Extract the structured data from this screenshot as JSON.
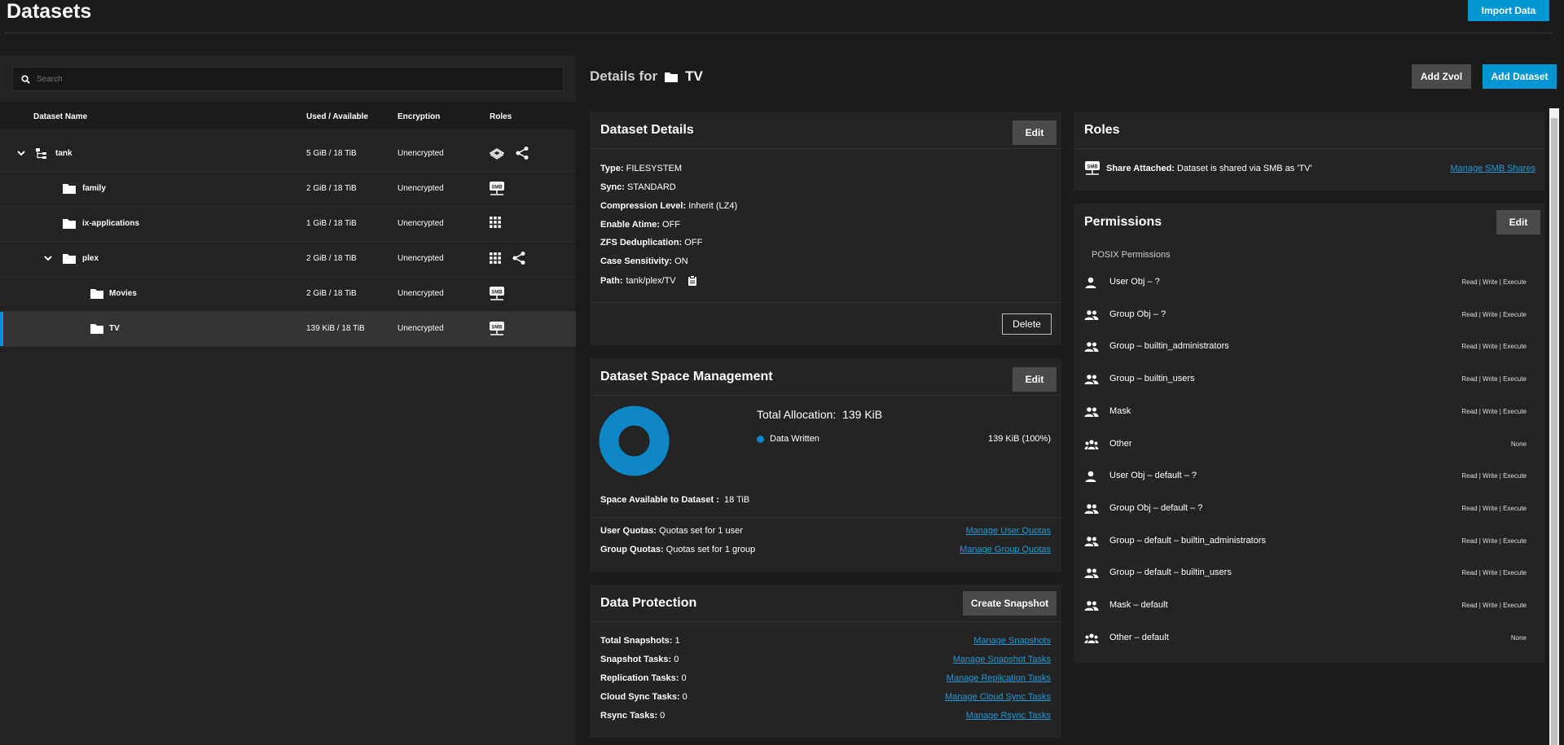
{
  "page": {
    "title": "Datasets",
    "import_label": "Import Data"
  },
  "search": {
    "placeholder": "Search"
  },
  "tree": {
    "headers": {
      "name": "Dataset Name",
      "used": "Used / Available",
      "encryption": "Encryption",
      "roles": "Roles"
    },
    "rows": [
      {
        "name": "tank",
        "used": "5 GiB / 18 TiB",
        "encryption": "Unencrypted"
      },
      {
        "name": "family",
        "used": "2 GiB / 18 TiB",
        "encryption": "Unencrypted"
      },
      {
        "name": "ix-applications",
        "used": "1 GiB / 18 TiB",
        "encryption": "Unencrypted"
      },
      {
        "name": "plex",
        "used": "2 GiB / 18 TiB",
        "encryption": "Unencrypted"
      },
      {
        "name": "Movies",
        "used": "2 GiB / 18 TiB",
        "encryption": "Unencrypted"
      },
      {
        "name": "TV",
        "used": "139 KiB / 18 TiB",
        "encryption": "Unencrypted"
      }
    ]
  },
  "details": {
    "title_prefix": "Details for",
    "dataset": "TV",
    "add_zvol": "Add Zvol",
    "add_dataset": "Add Dataset"
  },
  "dataset_details": {
    "title": "Dataset Details",
    "edit": "Edit",
    "delete": "Delete",
    "fields": [
      {
        "k": "Type:",
        "v": "FILESYSTEM"
      },
      {
        "k": "Sync:",
        "v": "STANDARD"
      },
      {
        "k": "Compression Level:",
        "v": "Inherit (LZ4)"
      },
      {
        "k": "Enable Atime:",
        "v": "OFF"
      },
      {
        "k": "ZFS Deduplication:",
        "v": "OFF"
      },
      {
        "k": "Case Sensitivity:",
        "v": "ON"
      },
      {
        "k": "Path:",
        "v": "tank/plex/TV"
      }
    ]
  },
  "space": {
    "title": "Dataset Space Management",
    "edit": "Edit",
    "total_label": "Total Allocation:",
    "total_value": "139 KiB",
    "legend_label": "Data Written",
    "legend_value": "139 KiB (100%)",
    "available_label": "Space Available to Dataset :",
    "available_value": "18 TiB",
    "user_quotas_label": "User Quotas:",
    "user_quotas_value": "Quotas set for 1 user",
    "user_quotas_link": "Manage User Quotas",
    "group_quotas_label": "Group Quotas:",
    "group_quotas_value": "Quotas set for 1 group",
    "group_quotas_link": "Manage Group Quotas",
    "donut_color": "#0d86c6",
    "data_written_fraction": 1.0
  },
  "protection": {
    "title": "Data Protection",
    "create_snapshot": "Create Snapshot",
    "rows": [
      {
        "k": "Total Snapshots:",
        "v": "1",
        "link": "Manage Snapshots"
      },
      {
        "k": "Snapshot Tasks:",
        "v": "0",
        "link": "Manage Snapshot Tasks"
      },
      {
        "k": "Replication Tasks:",
        "v": "0",
        "link": "Manage Replication Tasks"
      },
      {
        "k": "Cloud Sync Tasks:",
        "v": "0",
        "link": "Manage Cloud Sync Tasks"
      },
      {
        "k": "Rsync Tasks:",
        "v": "0",
        "link": "Manage Rsync Tasks"
      }
    ]
  },
  "roles": {
    "title": "Roles",
    "share_label": "Share Attached:",
    "share_text": "Dataset is shared via SMB as 'TV'",
    "manage_link": "Manage SMB Shares"
  },
  "permissions": {
    "title": "Permissions",
    "edit": "Edit",
    "subtitle": "POSIX Permissions",
    "rows": [
      {
        "label": "User Obj – ?",
        "value": "Read | Write | Execute",
        "icon": "user-icon"
      },
      {
        "label": "Group Obj – ?",
        "value": "Read | Write | Execute",
        "icon": "group-icon"
      },
      {
        "label": "Group – builtin_administrators",
        "value": "Read | Write | Execute",
        "icon": "group-icon"
      },
      {
        "label": "Group – builtin_users",
        "value": "Read | Write | Execute",
        "icon": "group-icon"
      },
      {
        "label": "Mask",
        "value": "Read | Write | Execute",
        "icon": "group-icon"
      },
      {
        "label": "Other",
        "value": "None",
        "icon": "people-icon"
      },
      {
        "label": "User Obj – default – ?",
        "value": "Read | Write | Execute",
        "icon": "user-icon"
      },
      {
        "label": "Group Obj – default – ?",
        "value": "Read | Write | Execute",
        "icon": "group-icon"
      },
      {
        "label": "Group – default – builtin_administrators",
        "value": "Read | Write | Execute",
        "icon": "group-icon"
      },
      {
        "label": "Group – default – builtin_users",
        "value": "Read | Write | Execute",
        "icon": "group-icon"
      },
      {
        "label": "Mask – default",
        "value": "Read | Write | Execute",
        "icon": "group-icon"
      },
      {
        "label": "Other – default",
        "value": "None",
        "icon": "people-icon"
      }
    ]
  },
  "colors": {
    "accent": "#0095d5",
    "link": "#2196d3",
    "panel": "#242424",
    "background": "#1b1b1b"
  }
}
